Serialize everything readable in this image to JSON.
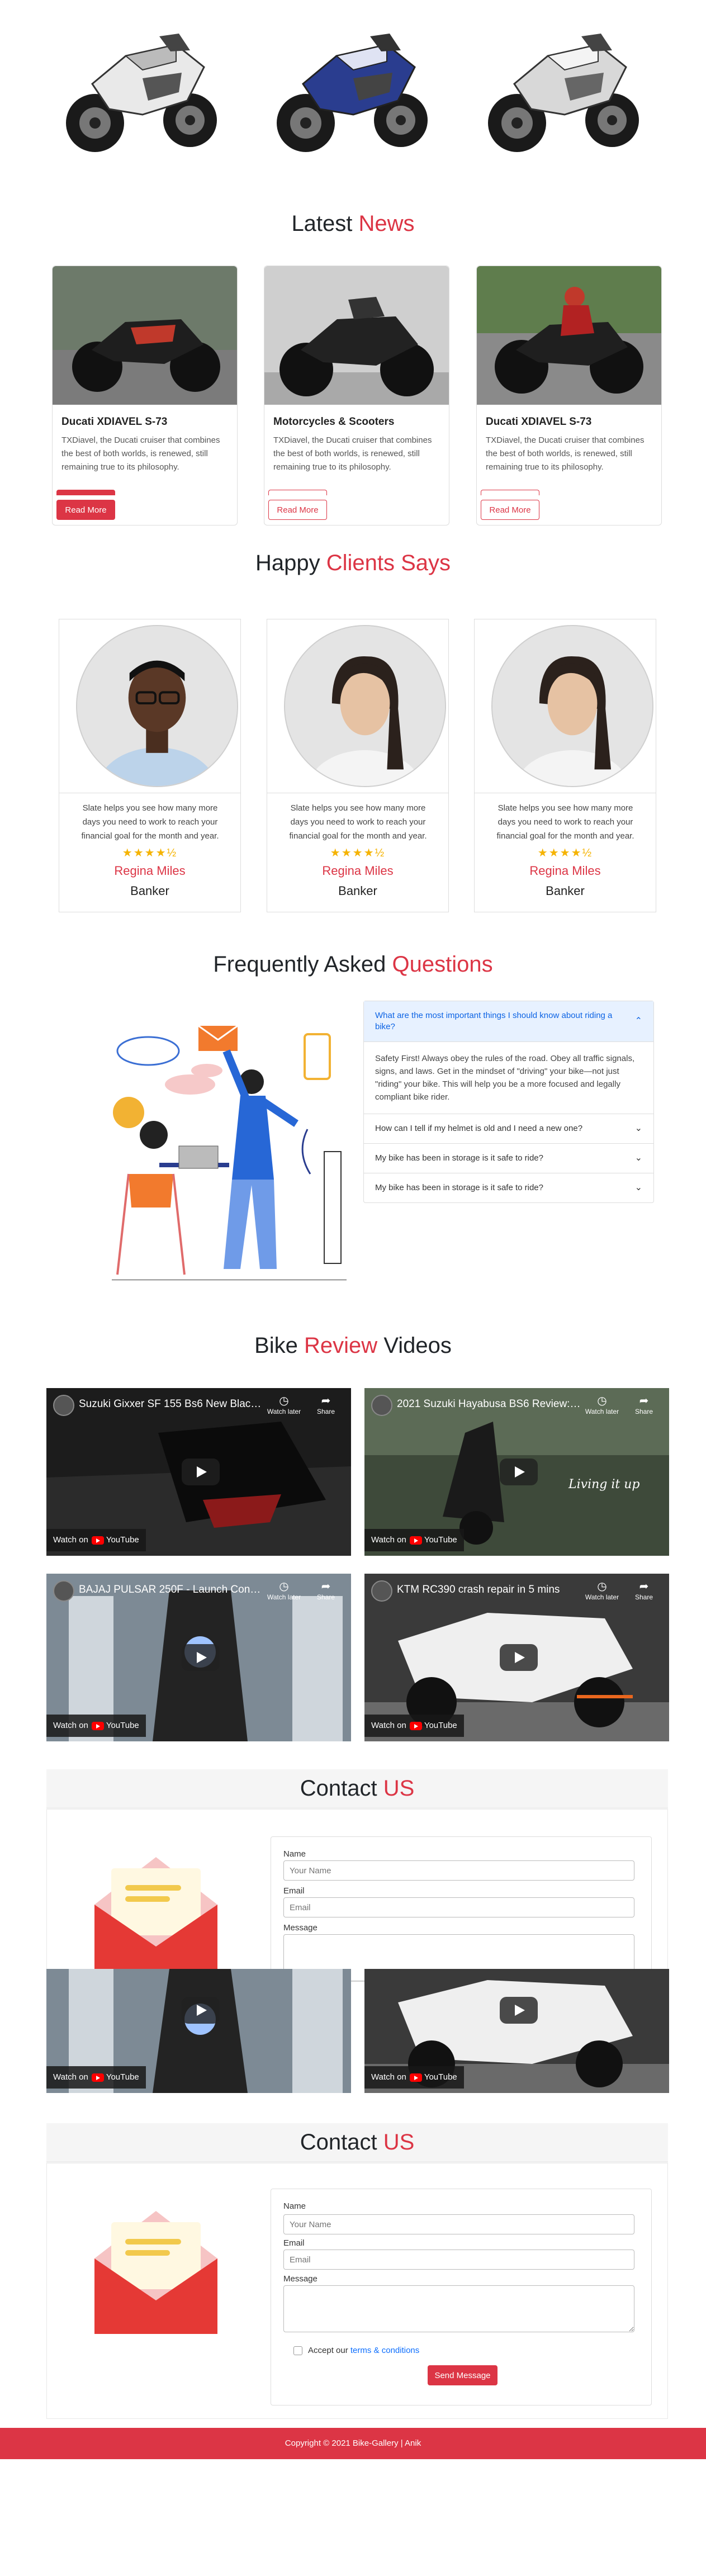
{
  "news": {
    "title_main": "Latest",
    "title_accent": "News",
    "cards": [
      {
        "title": "Ducati XDIAVEL S-73",
        "text": "TXDiavel, the Ducati cruiser that combines the best of both worlds, is renewed, still remaining true to its philosophy.",
        "button": "Read More"
      },
      {
        "title": "Motorcycles & Scooters",
        "text": "TXDiavel, the Ducati cruiser that combines the best of both worlds, is renewed, still remaining true to its philosophy.",
        "button": "Read More"
      },
      {
        "title": "Ducati XDIAVEL S-73",
        "text": "TXDiavel, the Ducati cruiser that combines the best of both worlds, is renewed, still remaining true to its philosophy.",
        "button": "Read More"
      }
    ]
  },
  "clients": {
    "title_main": "Happy",
    "title_accent": "Clients Says",
    "cards": [
      {
        "text": "Slate helps you see how many more days you need to work to reach your financial goal for the month and year.",
        "stars": "★★★★½",
        "name": "Regina Miles",
        "role": "Banker"
      },
      {
        "text": "Slate helps you see how many more days you need to work to reach your financial goal for the month and year.",
        "stars": "★★★★½",
        "name": "Regina Miles",
        "role": "Banker"
      },
      {
        "text": "Slate helps you see how many more days you need to work to reach your financial goal for the month and year.",
        "stars": "★★★★½",
        "name": "Regina Miles",
        "role": "Banker"
      }
    ]
  },
  "faq": {
    "title_main": "Frequently Asked",
    "title_accent": "Questions",
    "items": [
      {
        "q": "What are the most important things I should know about riding a bike?",
        "a": "Safety First! Always obey the rules of the road. Obey all traffic signals, signs, and laws. Get in the mindset of \"driving\" your bike—not just \"riding\" your bike. This will help you be a more focused and legally compliant bike rider."
      },
      {
        "q": "How can I tell if my helmet is old and I need a new one?"
      },
      {
        "q": "My bike has been in storage is it safe to ride?"
      },
      {
        "q": "My bike has been in storage is it safe to ride?"
      }
    ]
  },
  "videos": {
    "title_main": "Bike",
    "title_accent": "Review",
    "title_end": "Videos",
    "watch_later": "Watch later",
    "share": "Share",
    "watch_on": "Watch on",
    "youtube": "YouTube",
    "items": [
      {
        "title": "Suzuki Gixxer SF 155 Bs6 New Black ..."
      },
      {
        "title": "2021 Suzuki Hayabusa BS6 Review: S..."
      },
      {
        "title": "BAJAJ PULSAR 250F - Launch Confi..."
      },
      {
        "title": "KTM RC390 crash repair in 5 mins"
      }
    ],
    "overlay_text": "Living it up"
  },
  "contact": {
    "title_main": "Contact",
    "title_accent": "US",
    "name_label": "Name",
    "name_placeholder": "Your Name",
    "email_label": "Email",
    "email_placeholder": "Email",
    "message_label": "Message",
    "accept_text": "Accept our",
    "terms_link": "terms & conditions",
    "send_button": "Send Message"
  },
  "footer": {
    "text": "Copyright © 2021 Bike-Gallery | Anik"
  },
  "colors": {
    "accent": "#dc3545",
    "faq_open_bg": "#e7f1ff",
    "faq_open_text": "#0c63e4",
    "star": "#f5b301"
  }
}
